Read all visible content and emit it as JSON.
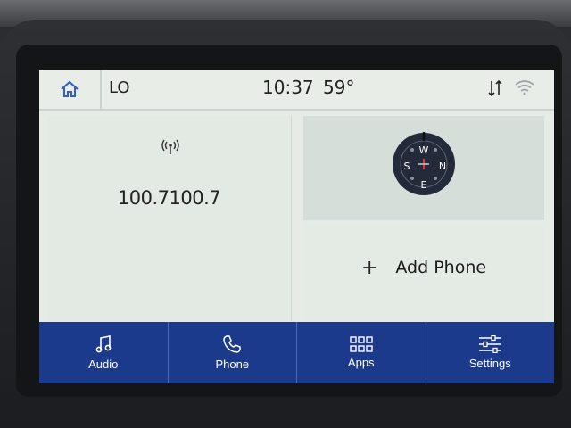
{
  "status_bar": {
    "climate": "LO",
    "time": "10:37",
    "temperature": "59°"
  },
  "radio": {
    "frequency": "100.7100.7"
  },
  "compass": {
    "letters": {
      "n": "N",
      "s": "S",
      "e": "E",
      "w": "W"
    }
  },
  "phone_tile": {
    "plus": "+",
    "label": "Add Phone"
  },
  "nav": {
    "audio": "Audio",
    "phone": "Phone",
    "apps": "Apps",
    "settings": "Settings"
  },
  "colors": {
    "nav_background": "#1c3a8c",
    "screen_background": "#e6ebe5",
    "home_icon": "#2f5fc8"
  },
  "icons": [
    "home-icon",
    "data-transfer-icon",
    "wifi-icon",
    "radio-signal-icon",
    "compass-icon",
    "music-note-icon",
    "phone-icon",
    "apps-grid-icon",
    "settings-sliders-icon"
  ]
}
